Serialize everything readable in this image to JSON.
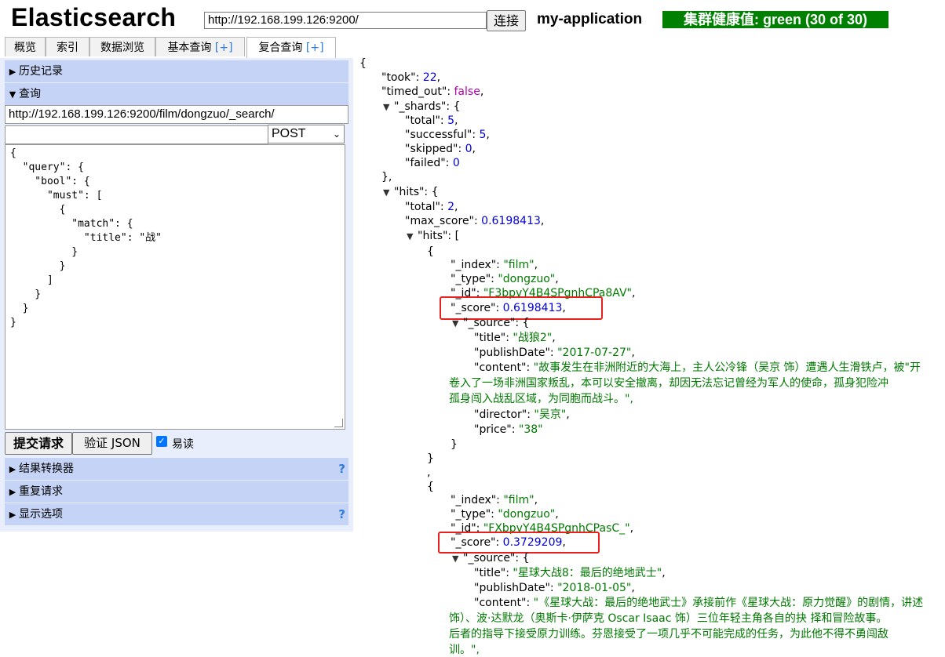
{
  "header": {
    "app_title": "Elasticsearch",
    "url_value": "http://192.168.199.126:9200/",
    "connect_label": "连接",
    "cluster_name": "my-application",
    "health_text": "集群健康值: green (30 of 30)",
    "health_color": "#008000"
  },
  "tabs": [
    {
      "label": "概览"
    },
    {
      "label": "索引"
    },
    {
      "label": "数据浏览"
    },
    {
      "label": "基本查询",
      "plus": "[+]"
    },
    {
      "label": "复合查询",
      "plus": "[+]"
    }
  ],
  "left": {
    "history_label": "历史记录",
    "query_label": "查询",
    "path_value": "http://192.168.199.126:9200/film/dongzuo/_search/",
    "method": "POST",
    "body": "{\n  \"query\": {\n    \"bool\": {\n      \"must\": [\n        {\n          \"match\": {\n            \"title\": \"战\"\n          }\n        }\n      ]\n    }\n  }\n}",
    "submit_label": "提交请求",
    "validate_label": "验证 JSON",
    "pretty_label": "易读",
    "pretty_checked": true,
    "transformer_label": "结果转换器",
    "repeat_label": "重复请求",
    "display_label": "显示选项",
    "help_glyph": "?"
  },
  "result": {
    "open_brace": "{",
    "took_key": "\"took\": ",
    "took_val": "22",
    "timed_out_key": "\"timed_out\": ",
    "timed_out_val": "false",
    "shards_key": "\"_shards\": {",
    "total_key": "\"total\": ",
    "total_val": "5",
    "successful_key": "\"successful\": ",
    "successful_val": "5",
    "skipped_key": "\"skipped\": ",
    "skipped_val": "0",
    "failed_key": "\"failed\": ",
    "failed_val": "0",
    "close_obj_comma": "},",
    "hits_key": "\"hits\": {",
    "hits_total_key": "\"total\": ",
    "hits_total_val": "2",
    "max_score_key": "\"max_score\": ",
    "max_score_val": "0.6198413",
    "hits_arr_key": "\"hits\": [",
    "hit1": {
      "open": "{",
      "index_key": "\"_index\": ",
      "index_val": "\"film\"",
      "type_key": "\"_type\": ",
      "type_val": "\"dongzuo\"",
      "id_key": "\"_id\": ",
      "id_val": "\"F3bpvY4B4SPgnhCPa8AV\"",
      "score_key": "\"_score\": ",
      "score_val": "0.6198413",
      "source_key": "\"_source\": {",
      "title_key": "\"title\": ",
      "title_val": "\"战狼2\"",
      "date_key": "\"publishDate\": ",
      "date_val": "\"2017-07-27\"",
      "content_key": "\"content\": ",
      "content_line1": "\"故事发生在非洲附近的大海上，主人公冷锋（吴京 饰）遭遇人生滑铁卢，被\"开",
      "content_line2": "卷入了一场非洲国家叛乱，本可以安全撤离，却因无法忘记曾经为军人的使命，孤身犯险冲",
      "content_line3": "孤身闯入战乱区域，为同胞而战斗。\",",
      "director_key": "\"director\": ",
      "director_val": "\"吴京\"",
      "price_key": "\"price\": ",
      "price_val": "\"38\"",
      "close_source": "}",
      "close": "}"
    },
    "separator": ",",
    "hit2": {
      "open": "{",
      "index_key": "\"_index\": ",
      "index_val": "\"film\"",
      "type_key": "\"_type\": ",
      "type_val": "\"dongzuo\"",
      "id_key": "\"_id\": ",
      "id_val": "\"FXbpvY4B4SPgnhCPasC_\"",
      "score_key": "\"_score\": ",
      "score_val": "0.3729209",
      "source_key": "\"_source\": {",
      "title_key": "\"title\": ",
      "title_val": "\"星球大战8：最后的绝地武士\"",
      "date_key": "\"publishDate\": ",
      "date_val": "\"2018-01-05\"",
      "content_key": "\"content\": ",
      "content_line1": "\"《星球大战：最后的绝地武士》承接前作《星球大战：原力觉醒》的剧情，讲述",
      "content_line2": "饰）、波·达默龙（奥斯卡·伊萨克 Oscar Isaac 饰）三位年轻主角各自的抉 择和冒险故事。",
      "content_line3": "后者的指导下接受原力训练。芬恩接受了一项几乎不可能完成的任务，为此他不得不勇闯敌",
      "content_line4": "训。\","
    },
    "accent_color": "#e8201e"
  }
}
